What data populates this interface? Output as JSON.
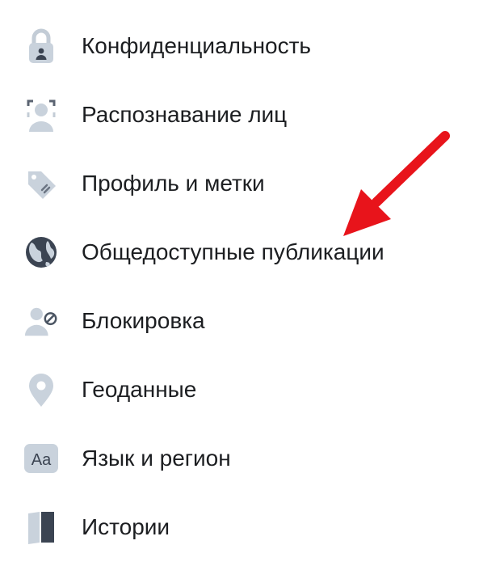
{
  "menu": {
    "items": [
      {
        "label": "Конфиденциальность",
        "icon": "lock-icon"
      },
      {
        "label": "Распознавание лиц",
        "icon": "face-recognition-icon"
      },
      {
        "label": "Профиль и метки",
        "icon": "tag-icon"
      },
      {
        "label": "Общедоступные публикации",
        "icon": "globe-icon"
      },
      {
        "label": "Блокировка",
        "icon": "user-block-icon"
      },
      {
        "label": "Геоданные",
        "icon": "location-pin-icon"
      },
      {
        "label": "Язык и регион",
        "icon": "language-icon"
      },
      {
        "label": "Истории",
        "icon": "stories-book-icon"
      }
    ]
  },
  "annotation": {
    "arrow_color": "#e8141b"
  },
  "colors": {
    "text": "#1c1e21",
    "icon_light": "#c9d2dc",
    "icon_dark": "#4b5563"
  }
}
